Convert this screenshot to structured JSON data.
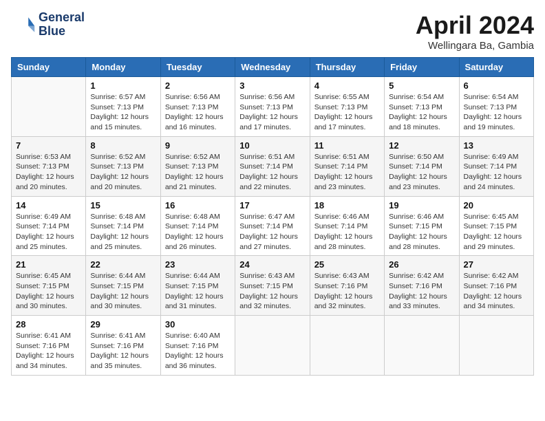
{
  "header": {
    "logo_line1": "General",
    "logo_line2": "Blue",
    "month": "April 2024",
    "location": "Wellingara Ba, Gambia"
  },
  "days_of_week": [
    "Sunday",
    "Monday",
    "Tuesday",
    "Wednesday",
    "Thursday",
    "Friday",
    "Saturday"
  ],
  "weeks": [
    [
      {
        "day": "",
        "info": ""
      },
      {
        "day": "1",
        "info": "Sunrise: 6:57 AM\nSunset: 7:13 PM\nDaylight: 12 hours\nand 15 minutes."
      },
      {
        "day": "2",
        "info": "Sunrise: 6:56 AM\nSunset: 7:13 PM\nDaylight: 12 hours\nand 16 minutes."
      },
      {
        "day": "3",
        "info": "Sunrise: 6:56 AM\nSunset: 7:13 PM\nDaylight: 12 hours\nand 17 minutes."
      },
      {
        "day": "4",
        "info": "Sunrise: 6:55 AM\nSunset: 7:13 PM\nDaylight: 12 hours\nand 17 minutes."
      },
      {
        "day": "5",
        "info": "Sunrise: 6:54 AM\nSunset: 7:13 PM\nDaylight: 12 hours\nand 18 minutes."
      },
      {
        "day": "6",
        "info": "Sunrise: 6:54 AM\nSunset: 7:13 PM\nDaylight: 12 hours\nand 19 minutes."
      }
    ],
    [
      {
        "day": "7",
        "info": "Sunrise: 6:53 AM\nSunset: 7:13 PM\nDaylight: 12 hours\nand 20 minutes."
      },
      {
        "day": "8",
        "info": "Sunrise: 6:52 AM\nSunset: 7:13 PM\nDaylight: 12 hours\nand 20 minutes."
      },
      {
        "day": "9",
        "info": "Sunrise: 6:52 AM\nSunset: 7:13 PM\nDaylight: 12 hours\nand 21 minutes."
      },
      {
        "day": "10",
        "info": "Sunrise: 6:51 AM\nSunset: 7:14 PM\nDaylight: 12 hours\nand 22 minutes."
      },
      {
        "day": "11",
        "info": "Sunrise: 6:51 AM\nSunset: 7:14 PM\nDaylight: 12 hours\nand 23 minutes."
      },
      {
        "day": "12",
        "info": "Sunrise: 6:50 AM\nSunset: 7:14 PM\nDaylight: 12 hours\nand 23 minutes."
      },
      {
        "day": "13",
        "info": "Sunrise: 6:49 AM\nSunset: 7:14 PM\nDaylight: 12 hours\nand 24 minutes."
      }
    ],
    [
      {
        "day": "14",
        "info": "Sunrise: 6:49 AM\nSunset: 7:14 PM\nDaylight: 12 hours\nand 25 minutes."
      },
      {
        "day": "15",
        "info": "Sunrise: 6:48 AM\nSunset: 7:14 PM\nDaylight: 12 hours\nand 25 minutes."
      },
      {
        "day": "16",
        "info": "Sunrise: 6:48 AM\nSunset: 7:14 PM\nDaylight: 12 hours\nand 26 minutes."
      },
      {
        "day": "17",
        "info": "Sunrise: 6:47 AM\nSunset: 7:14 PM\nDaylight: 12 hours\nand 27 minutes."
      },
      {
        "day": "18",
        "info": "Sunrise: 6:46 AM\nSunset: 7:14 PM\nDaylight: 12 hours\nand 28 minutes."
      },
      {
        "day": "19",
        "info": "Sunrise: 6:46 AM\nSunset: 7:15 PM\nDaylight: 12 hours\nand 28 minutes."
      },
      {
        "day": "20",
        "info": "Sunrise: 6:45 AM\nSunset: 7:15 PM\nDaylight: 12 hours\nand 29 minutes."
      }
    ],
    [
      {
        "day": "21",
        "info": "Sunrise: 6:45 AM\nSunset: 7:15 PM\nDaylight: 12 hours\nand 30 minutes."
      },
      {
        "day": "22",
        "info": "Sunrise: 6:44 AM\nSunset: 7:15 PM\nDaylight: 12 hours\nand 30 minutes."
      },
      {
        "day": "23",
        "info": "Sunrise: 6:44 AM\nSunset: 7:15 PM\nDaylight: 12 hours\nand 31 minutes."
      },
      {
        "day": "24",
        "info": "Sunrise: 6:43 AM\nSunset: 7:15 PM\nDaylight: 12 hours\nand 32 minutes."
      },
      {
        "day": "25",
        "info": "Sunrise: 6:43 AM\nSunset: 7:16 PM\nDaylight: 12 hours\nand 32 minutes."
      },
      {
        "day": "26",
        "info": "Sunrise: 6:42 AM\nSunset: 7:16 PM\nDaylight: 12 hours\nand 33 minutes."
      },
      {
        "day": "27",
        "info": "Sunrise: 6:42 AM\nSunset: 7:16 PM\nDaylight: 12 hours\nand 34 minutes."
      }
    ],
    [
      {
        "day": "28",
        "info": "Sunrise: 6:41 AM\nSunset: 7:16 PM\nDaylight: 12 hours\nand 34 minutes."
      },
      {
        "day": "29",
        "info": "Sunrise: 6:41 AM\nSunset: 7:16 PM\nDaylight: 12 hours\nand 35 minutes."
      },
      {
        "day": "30",
        "info": "Sunrise: 6:40 AM\nSunset: 7:16 PM\nDaylight: 12 hours\nand 36 minutes."
      },
      {
        "day": "",
        "info": ""
      },
      {
        "day": "",
        "info": ""
      },
      {
        "day": "",
        "info": ""
      },
      {
        "day": "",
        "info": ""
      }
    ]
  ]
}
